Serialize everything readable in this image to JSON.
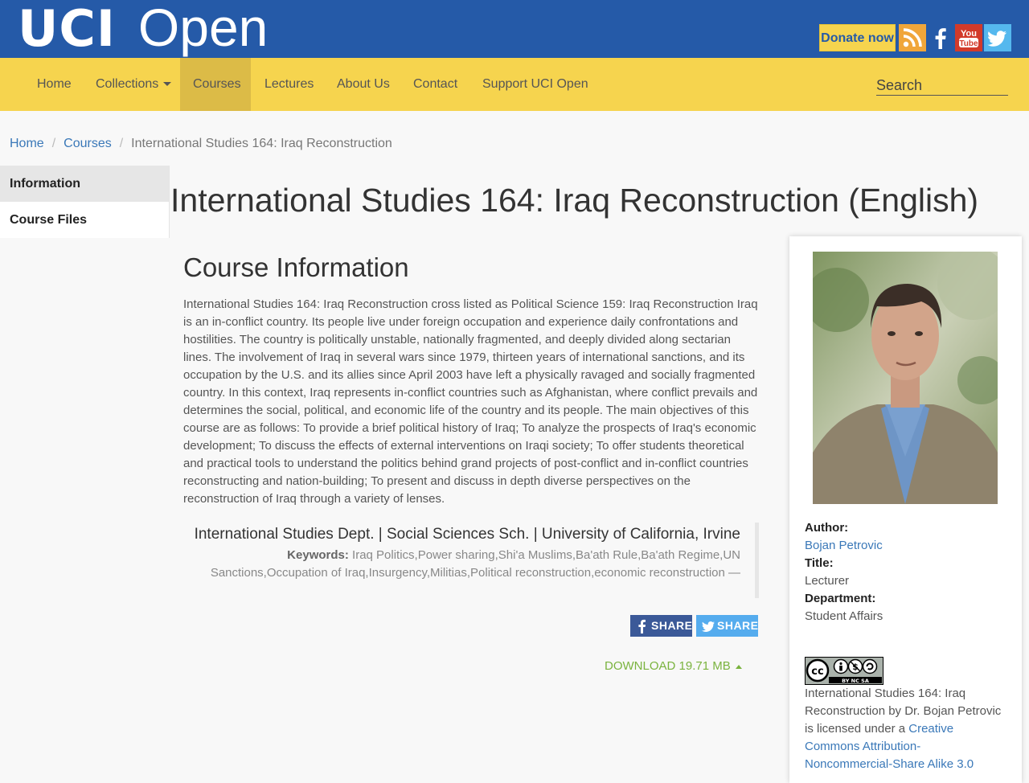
{
  "header": {
    "logo_bold": "UCI",
    "logo_light": "Open",
    "donate_label": "Donate now",
    "social_icons": [
      "rss-icon",
      "facebook-icon",
      "youtube-icon",
      "twitter-icon"
    ],
    "youtube_text_top": "You",
    "youtube_text_bottom": "Tube"
  },
  "nav": {
    "items": [
      {
        "label": "Home"
      },
      {
        "label": "Collections"
      },
      {
        "label": "Courses"
      },
      {
        "label": "Lectures"
      },
      {
        "label": "About Us"
      },
      {
        "label": "Contact"
      },
      {
        "label": "Support UCI Open"
      }
    ],
    "active_index": 2,
    "search_placeholder": "Search"
  },
  "breadcrumb": {
    "items": [
      "Home",
      "Courses",
      "International Studies 164: Iraq Reconstruction"
    ]
  },
  "sidenav": {
    "items": [
      "Information",
      "Course Files"
    ],
    "active_index": 0
  },
  "main": {
    "title": "International Studies 164: Iraq Reconstruction (English)",
    "section_title": "Course Information",
    "description": "International Studies 164: Iraq Reconstruction cross listed as Political Science 159: Iraq Reconstruction Iraq is an in-conflict country. Its people live under foreign occupation and experience daily confrontations and hostilities. The country is politically unstable, nationally fragmented, and deeply divided along sectarian lines. The involvement of Iraq in several wars since 1979, thirteen years of international sanctions, and its occupation by the U.S. and its allies since April 2003 have left a physically ravaged and socially fragmented country. In this context, Iraq represents in-conflict countries such as Afghanistan, where conflict prevails and determines the social, political, and economic life of the country and its people. The main objectives of this course are as follows: To provide a brief political history of Iraq; To analyze the prospects of Iraq's economic development; To discuss the effects of external interventions on Iraqi society; To offer students theoretical and practical tools to understand the politics behind grand projects of post-conflict and in-conflict countries reconstructing and nation-building; To present and discuss in depth diverse perspectives on the reconstruction of Iraq through a variety of lenses.",
    "dept_line": "International Studies Dept. | Social Sciences Sch. | University of California, Irvine",
    "keywords_label": "Keywords:",
    "keywords": "Iraq Politics,Power sharing,Shi'a Muslims,Ba'ath Rule,Ba'ath Regime,UN Sanctions,Occupation of Iraq,Insurgency,Militias,Political reconstruction,economic reconstruction —",
    "share_fb": "SHARE",
    "share_tw": "SHARE",
    "download": "DOWNLOAD 19.71 MB"
  },
  "card": {
    "author_label": "Author:",
    "author_name": "Bojan Petrovic",
    "title_label": "Title:",
    "title_value": "Lecturer",
    "dept_label": "Department:",
    "dept_value": "Student Affairs",
    "cc_text": "BY NC SA",
    "license_text": "International Studies 164: Iraq Reconstruction by Dr. Bojan Petrovic is licensed under a",
    "license_link": "Creative Commons Attribution-Noncommercial-Share Alike 3.0"
  },
  "colors": {
    "header_blue": "#255aa8",
    "nav_yellow": "#f6d44e",
    "nav_active": "#dcbb47",
    "link_blue": "#3a78b8",
    "download_green": "#7ab33e",
    "facebook_blue": "#3b5998",
    "twitter_blue": "#55acee"
  }
}
